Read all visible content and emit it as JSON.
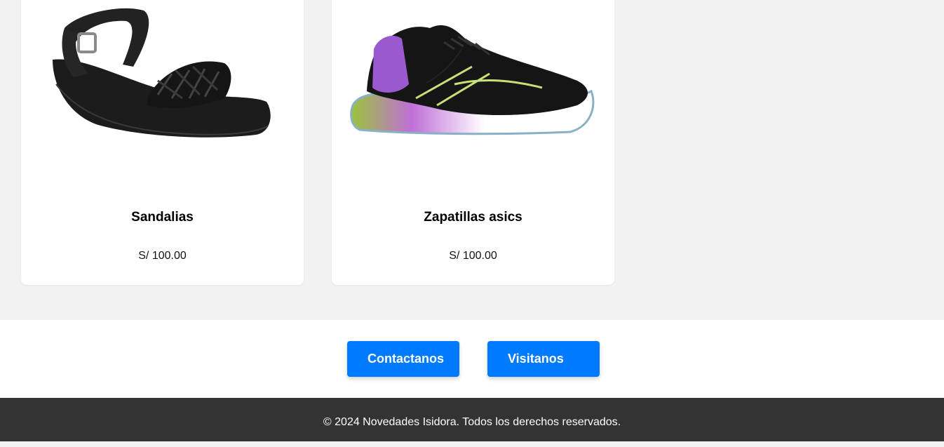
{
  "products": [
    {
      "name": "Sandalias",
      "price": "S/ 100.00",
      "image_icon": "sandal-image"
    },
    {
      "name": "Zapatillas asics",
      "price": "S/ 100.00",
      "image_icon": "sneaker-image"
    }
  ],
  "actions": {
    "contact_label": "Contactanos",
    "visit_label": "Visitanos"
  },
  "footer": {
    "copyright": "© 2024 Novedades Isidora. Todos los derechos reservados."
  },
  "colors": {
    "accent": "#007bff",
    "footer_bg": "#333333",
    "page_bg": "#f2f2f2"
  }
}
